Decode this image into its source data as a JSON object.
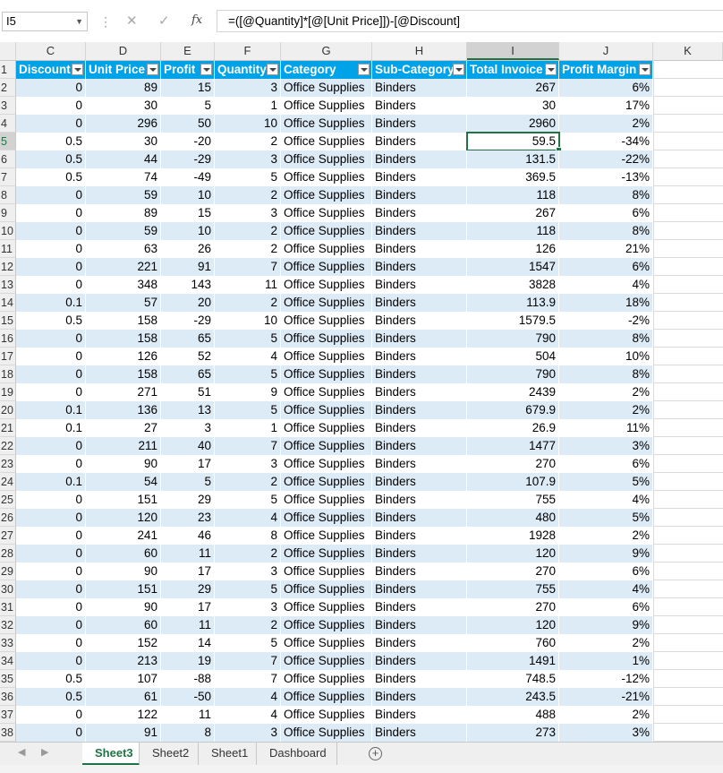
{
  "formula_bar": {
    "name_box": "I5",
    "cancel_icon": "close-icon",
    "enter_icon": "checkmark-icon",
    "fx_label": "fx",
    "formula": "=([@Quantity]*[@[Unit Price]])-[@Discount]"
  },
  "columns": [
    "C",
    "D",
    "E",
    "F",
    "G",
    "H",
    "I",
    "J",
    "K"
  ],
  "header_row": {
    "row_number": "1",
    "labels": [
      "Discount",
      "Unit Price",
      "Profit",
      "Quantity",
      "Category",
      "Sub-Category",
      "Total Invoice",
      "Profit Margin"
    ]
  },
  "rows": [
    {
      "n": "2",
      "v": [
        "0",
        "89",
        "15",
        "3",
        "Office Supplies",
        "Binders",
        "267",
        "6%"
      ]
    },
    {
      "n": "3",
      "v": [
        "0",
        "30",
        "5",
        "1",
        "Office Supplies",
        "Binders",
        "30",
        "17%"
      ]
    },
    {
      "n": "4",
      "v": [
        "0",
        "296",
        "50",
        "10",
        "Office Supplies",
        "Binders",
        "2960",
        "2%"
      ]
    },
    {
      "n": "5",
      "v": [
        "0.5",
        "30",
        "-20",
        "2",
        "Office Supplies",
        "Binders",
        "59.5",
        "-34%"
      ]
    },
    {
      "n": "6",
      "v": [
        "0.5",
        "44",
        "-29",
        "3",
        "Office Supplies",
        "Binders",
        "131.5",
        "-22%"
      ]
    },
    {
      "n": "7",
      "v": [
        "0.5",
        "74",
        "-49",
        "5",
        "Office Supplies",
        "Binders",
        "369.5",
        "-13%"
      ]
    },
    {
      "n": "8",
      "v": [
        "0",
        "59",
        "10",
        "2",
        "Office Supplies",
        "Binders",
        "118",
        "8%"
      ]
    },
    {
      "n": "9",
      "v": [
        "0",
        "89",
        "15",
        "3",
        "Office Supplies",
        "Binders",
        "267",
        "6%"
      ]
    },
    {
      "n": "10",
      "v": [
        "0",
        "59",
        "10",
        "2",
        "Office Supplies",
        "Binders",
        "118",
        "8%"
      ]
    },
    {
      "n": "11",
      "v": [
        "0",
        "63",
        "26",
        "2",
        "Office Supplies",
        "Binders",
        "126",
        "21%"
      ]
    },
    {
      "n": "12",
      "v": [
        "0",
        "221",
        "91",
        "7",
        "Office Supplies",
        "Binders",
        "1547",
        "6%"
      ]
    },
    {
      "n": "13",
      "v": [
        "0",
        "348",
        "143",
        "11",
        "Office Supplies",
        "Binders",
        "3828",
        "4%"
      ]
    },
    {
      "n": "14",
      "v": [
        "0.1",
        "57",
        "20",
        "2",
        "Office Supplies",
        "Binders",
        "113.9",
        "18%"
      ]
    },
    {
      "n": "15",
      "v": [
        "0.5",
        "158",
        "-29",
        "10",
        "Office Supplies",
        "Binders",
        "1579.5",
        "-2%"
      ]
    },
    {
      "n": "16",
      "v": [
        "0",
        "158",
        "65",
        "5",
        "Office Supplies",
        "Binders",
        "790",
        "8%"
      ]
    },
    {
      "n": "17",
      "v": [
        "0",
        "126",
        "52",
        "4",
        "Office Supplies",
        "Binders",
        "504",
        "10%"
      ]
    },
    {
      "n": "18",
      "v": [
        "0",
        "158",
        "65",
        "5",
        "Office Supplies",
        "Binders",
        "790",
        "8%"
      ]
    },
    {
      "n": "19",
      "v": [
        "0",
        "271",
        "51",
        "9",
        "Office Supplies",
        "Binders",
        "2439",
        "2%"
      ]
    },
    {
      "n": "20",
      "v": [
        "0.1",
        "136",
        "13",
        "5",
        "Office Supplies",
        "Binders",
        "679.9",
        "2%"
      ]
    },
    {
      "n": "21",
      "v": [
        "0.1",
        "27",
        "3",
        "1",
        "Office Supplies",
        "Binders",
        "26.9",
        "11%"
      ]
    },
    {
      "n": "22",
      "v": [
        "0",
        "211",
        "40",
        "7",
        "Office Supplies",
        "Binders",
        "1477",
        "3%"
      ]
    },
    {
      "n": "23",
      "v": [
        "0",
        "90",
        "17",
        "3",
        "Office Supplies",
        "Binders",
        "270",
        "6%"
      ]
    },
    {
      "n": "24",
      "v": [
        "0.1",
        "54",
        "5",
        "2",
        "Office Supplies",
        "Binders",
        "107.9",
        "5%"
      ]
    },
    {
      "n": "25",
      "v": [
        "0",
        "151",
        "29",
        "5",
        "Office Supplies",
        "Binders",
        "755",
        "4%"
      ]
    },
    {
      "n": "26",
      "v": [
        "0",
        "120",
        "23",
        "4",
        "Office Supplies",
        "Binders",
        "480",
        "5%"
      ]
    },
    {
      "n": "27",
      "v": [
        "0",
        "241",
        "46",
        "8",
        "Office Supplies",
        "Binders",
        "1928",
        "2%"
      ]
    },
    {
      "n": "28",
      "v": [
        "0",
        "60",
        "11",
        "2",
        "Office Supplies",
        "Binders",
        "120",
        "9%"
      ]
    },
    {
      "n": "29",
      "v": [
        "0",
        "90",
        "17",
        "3",
        "Office Supplies",
        "Binders",
        "270",
        "6%"
      ]
    },
    {
      "n": "30",
      "v": [
        "0",
        "151",
        "29",
        "5",
        "Office Supplies",
        "Binders",
        "755",
        "4%"
      ]
    },
    {
      "n": "31",
      "v": [
        "0",
        "90",
        "17",
        "3",
        "Office Supplies",
        "Binders",
        "270",
        "6%"
      ]
    },
    {
      "n": "32",
      "v": [
        "0",
        "60",
        "11",
        "2",
        "Office Supplies",
        "Binders",
        "120",
        "9%"
      ]
    },
    {
      "n": "33",
      "v": [
        "0",
        "152",
        "14",
        "5",
        "Office Supplies",
        "Binders",
        "760",
        "2%"
      ]
    },
    {
      "n": "34",
      "v": [
        "0",
        "213",
        "19",
        "7",
        "Office Supplies",
        "Binders",
        "1491",
        "1%"
      ]
    },
    {
      "n": "35",
      "v": [
        "0.5",
        "107",
        "-88",
        "7",
        "Office Supplies",
        "Binders",
        "748.5",
        "-12%"
      ]
    },
    {
      "n": "36",
      "v": [
        "0.5",
        "61",
        "-50",
        "4",
        "Office Supplies",
        "Binders",
        "243.5",
        "-21%"
      ]
    },
    {
      "n": "37",
      "v": [
        "0",
        "122",
        "11",
        "4",
        "Office Supplies",
        "Binders",
        "488",
        "2%"
      ]
    },
    {
      "n": "38",
      "v": [
        "0",
        "91",
        "8",
        "3",
        "Office Supplies",
        "Binders",
        "273",
        "3%"
      ]
    }
  ],
  "active_cell": {
    "row": "5",
    "column": "I"
  },
  "sheet_tabs": [
    "Sheet3",
    "Sheet2",
    "Sheet1",
    "Dashboard"
  ],
  "active_tab": "Sheet3",
  "colors": {
    "header_blue": "#00a2e8",
    "band_blue": "#ddebf7",
    "excel_green": "#217346"
  }
}
